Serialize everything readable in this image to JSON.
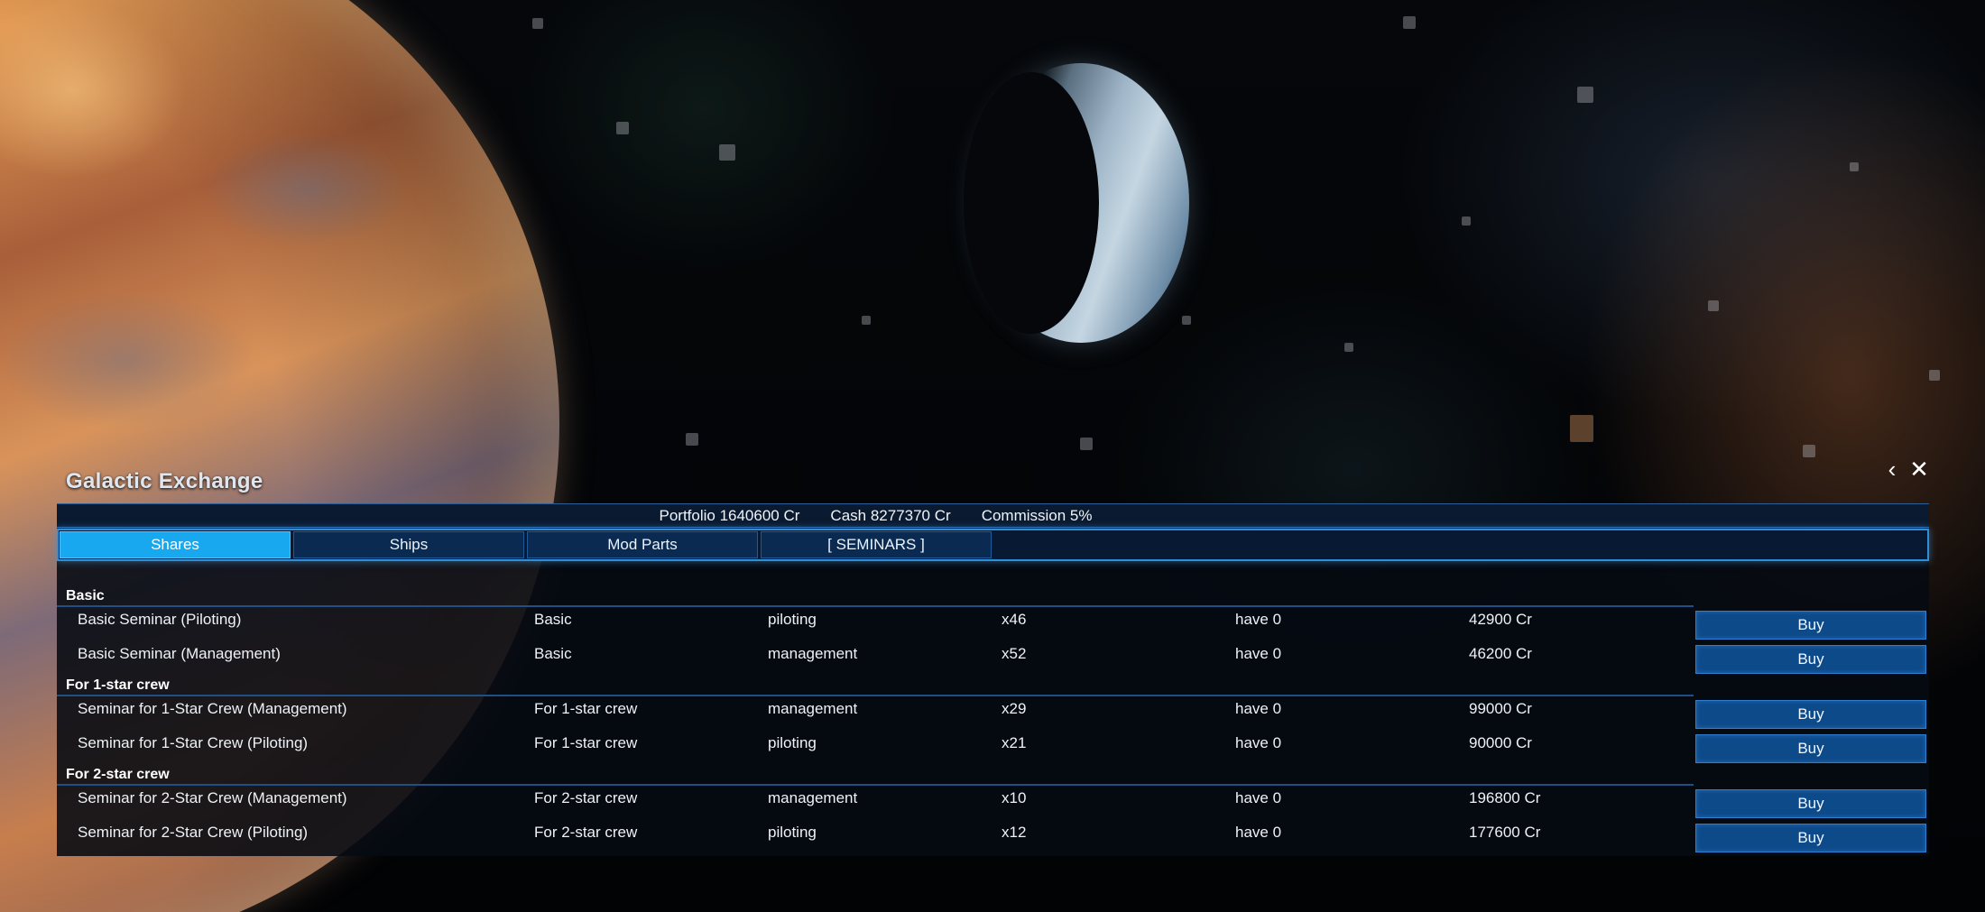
{
  "window": {
    "title": "Galactic Exchange",
    "controls": [
      {
        "icon": "chevron-left-icon",
        "glyph": "‹"
      },
      {
        "icon": "close-icon",
        "glyph": "✕"
      }
    ]
  },
  "summary": {
    "portfolio": "Portfolio 1640600 Cr",
    "cash": "Cash 8277370 Cr",
    "commission": "Commission 5%"
  },
  "tabs": [
    {
      "label": "Shares",
      "active": true
    },
    {
      "label": "Ships",
      "active": false
    },
    {
      "label": "Mod Parts",
      "active": false
    },
    {
      "label": "[ SEMINARS ]",
      "active": false
    }
  ],
  "groups": [
    {
      "label": "Basic",
      "items": [
        {
          "name": "Basic Seminar (Piloting)",
          "tier": "Basic",
          "skill": "piloting",
          "mult": "x46",
          "have": "have 0",
          "price": "42900 Cr",
          "action": "Buy"
        },
        {
          "name": "Basic Seminar (Management)",
          "tier": "Basic",
          "skill": "management",
          "mult": "x52",
          "have": "have 0",
          "price": "46200 Cr",
          "action": "Buy"
        }
      ]
    },
    {
      "label": "For 1-star crew",
      "items": [
        {
          "name": "Seminar for 1-Star Crew (Management)",
          "tier": "For 1-star crew",
          "skill": "management",
          "mult": "x29",
          "have": "have 0",
          "price": "99000 Cr",
          "action": "Buy"
        },
        {
          "name": "Seminar for 1-Star Crew (Piloting)",
          "tier": "For 1-star crew",
          "skill": "piloting",
          "mult": "x21",
          "have": "have 0",
          "price": "90000 Cr",
          "action": "Buy"
        }
      ]
    },
    {
      "label": "For 2-star crew",
      "items": [
        {
          "name": "Seminar for 2-Star Crew (Management)",
          "tier": "For 2-star crew",
          "skill": "management",
          "mult": "x10",
          "have": "have 0",
          "price": "196800 Cr",
          "action": "Buy"
        },
        {
          "name": "Seminar for 2-Star Crew (Piloting)",
          "tier": "For 2-star crew",
          "skill": "piloting",
          "mult": "x12",
          "have": "have 0",
          "price": "177600 Cr",
          "action": "Buy"
        }
      ]
    }
  ]
}
